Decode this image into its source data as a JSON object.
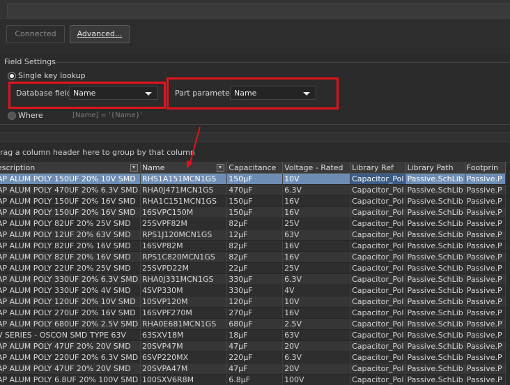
{
  "buttons": {
    "connected": "Connected",
    "advanced": "Advanced..."
  },
  "field_settings": {
    "title": "Field Settings",
    "single_key": "Single key lookup",
    "database_field_label": "Database field",
    "database_field_value": "Name",
    "part_parameter_label": "Part parameter",
    "part_parameter_value": "Name",
    "where_label": "Where",
    "where_expr": "[Name] = '{Name}'"
  },
  "group_hint": "rag a column header here to group by that column",
  "columns": [
    "escription",
    "Name",
    "Capacitance",
    "Voltage - Rated",
    "Library Ref",
    "Library Path",
    "Footprin"
  ],
  "rows": [
    [
      "AP ALUM POLY 150UF 20% 10V SMD",
      "RHS1A151MCN1GS",
      "150µF",
      "10V",
      "Capacitor_Pol",
      "Passive.SchLib",
      "Passive.P"
    ],
    [
      "AP ALUM POLY 470UF 20% 6.3V SMD",
      "RHA0J471MCN1GS",
      "470µF",
      "6.3V",
      "Capacitor_Pol",
      "Passive.SchLib",
      "Passive.P"
    ],
    [
      "AP ALUM POLY 150UF 20% 16V SMD",
      "RHA1C151MCN1GS",
      "150µF",
      "16V",
      "Capacitor_Pol",
      "Passive.SchLib",
      "Passive.P"
    ],
    [
      "AP ALUM POLY 150UF 20% 16V SMD",
      "16SVPC150M",
      "150µF",
      "16V",
      "Capacitor_Pol",
      "Passive.SchLib",
      "Passive.P"
    ],
    [
      "AP ALUM POLY 82UF 20% 25V SMD",
      "25SVPF82M",
      "82µF",
      "25V",
      "Capacitor_Pol",
      "Passive.SchLib",
      "Passive.P"
    ],
    [
      "AP ALUM POLY 12UF 20% 63V SMD",
      "RPS1J120MCN1GS",
      "12µF",
      "63V",
      "Capacitor_Pol",
      "Passive.SchLib",
      "Passive.P"
    ],
    [
      "AP ALUM POLY 82UF 20% 16V SMD",
      "16SVP82M",
      "82µF",
      "16V",
      "Capacitor_Pol",
      "Passive.SchLib",
      "Passive.P"
    ],
    [
      "AP ALUM POLY 82UF 20% 16V SMD",
      "RPS1C820MCN1GS",
      "82µF",
      "16V",
      "Capacitor_Pol",
      "Passive.SchLib",
      "Passive.P"
    ],
    [
      "AP ALUM POLY 22UF 20% 25V SMD",
      "25SVPD22M",
      "22µF",
      "25V",
      "Capacitor_Pol",
      "Passive.SchLib",
      "Passive.P"
    ],
    [
      "AP ALUM POLY 330UF 20% 6.3V SMD",
      "RHA0J331MCN1GS",
      "330µF",
      "6.3V",
      "Capacitor_Pol",
      "Passive.SchLib",
      "Passive.P"
    ],
    [
      "AP ALUM POLY 330UF 20% 4V SMD",
      "4SVP330M",
      "330µF",
      "4V",
      "Capacitor_Pol",
      "Passive.SchLib",
      "Passive.P"
    ],
    [
      "AP ALUM POLY 120UF 20% 10V SMD",
      "10SVP120M",
      "120µF",
      "10V",
      "Capacitor_Pol",
      "Passive.SchLib",
      "Passive.P"
    ],
    [
      "AP ALUM POLY 270UF 20% 16V SMD",
      "16SVPF270M",
      "270µF",
      "16V",
      "Capacitor_Pol",
      "Passive.SchLib",
      "Passive.P"
    ],
    [
      "AP ALUM POLY 680UF 20% 2.5V SMD",
      "RHA0E681MCN1GS",
      "680µF",
      "2.5V",
      "Capacitor_Pol",
      "Passive.SchLib",
      "Passive.P"
    ],
    [
      "V SERIES - OSCON SMD TYPE 63V",
      "63SXV18M",
      "18µF",
      "63V",
      "Capacitor_Pol",
      "Passive.SchLib",
      "Passive.P"
    ],
    [
      "AP ALUM POLY 47UF 20% 20V SMD",
      "20SVP47M",
      "47µF",
      "20V",
      "Capacitor_Pol",
      "Passive.SchLib",
      "Passive.P"
    ],
    [
      "AP ALUM POLY 220UF 20% 6.3V SMD",
      "6SVP220MX",
      "220µF",
      "6.3V",
      "Capacitor_Pol",
      "Passive.SchLib",
      "Passive.P"
    ],
    [
      "AP ALUM POLY 47UF 20% 20V SMD",
      "20SVPA47M",
      "47µF",
      "20V",
      "Capacitor_Pol",
      "Passive.SchLib",
      "Passive.P"
    ],
    [
      "AP ALUM POLY 6.8UF 20% 100V SMD",
      "100SXV6R8M",
      "6.8µF",
      "100V",
      "Capacitor_Pol",
      "Passive.SchLib",
      "Passive.P"
    ]
  ],
  "colors": {
    "accent_red": "#e0141c",
    "selection": "#6e8db4"
  }
}
